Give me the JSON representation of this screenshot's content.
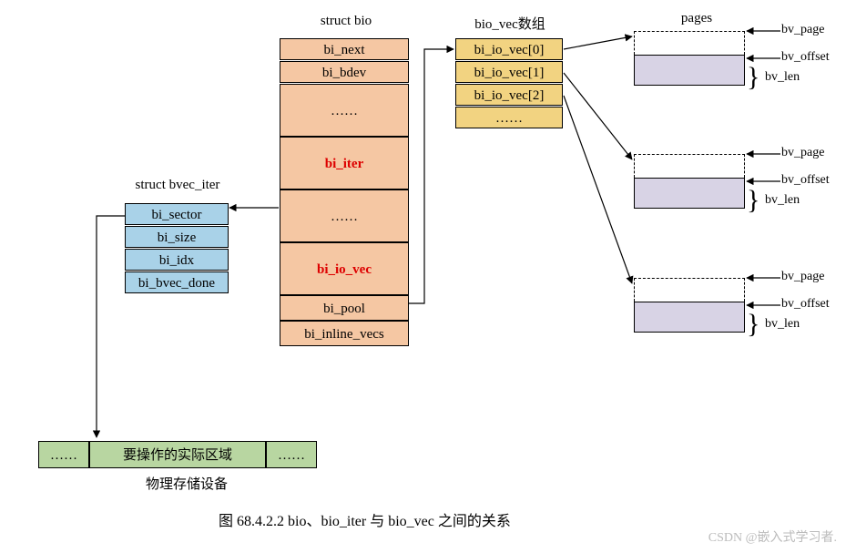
{
  "titles": {
    "struct_bio": "struct bio",
    "bio_vec_array": "bio_vec数组",
    "pages": "pages",
    "struct_bvec_iter": "struct bvec_iter"
  },
  "struct_bio": {
    "bi_next": "bi_next",
    "bi_bdev": "bi_bdev",
    "ellipsis1": "……",
    "bi_iter": "bi_iter",
    "ellipsis2": "……",
    "bi_io_vec": "bi_io_vec",
    "bi_pool": "bi_pool",
    "bi_inline_vecs": "bi_inline_vecs"
  },
  "bvec_iter": {
    "bi_sector": "bi_sector",
    "bi_size": "bi_size",
    "bi_idx": "bi_idx",
    "bi_bvec_done": "bi_bvec_done"
  },
  "bio_vec": {
    "v0": "bi_io_vec[0]",
    "v1": "bi_io_vec[1]",
    "v2": "bi_io_vec[2]",
    "ellipsis": "……"
  },
  "page_labels": {
    "bv_page": "bv_page",
    "bv_offset": "bv_offset",
    "bv_len": "bv_len"
  },
  "storage": {
    "left": "……",
    "center": "要操作的实际区域",
    "right": "……",
    "label": "物理存储设备"
  },
  "caption": "图 68.4.2.2 bio、bio_iter 与 bio_vec 之间的关系",
  "watermark": "CSDN @嵌入式学习者."
}
